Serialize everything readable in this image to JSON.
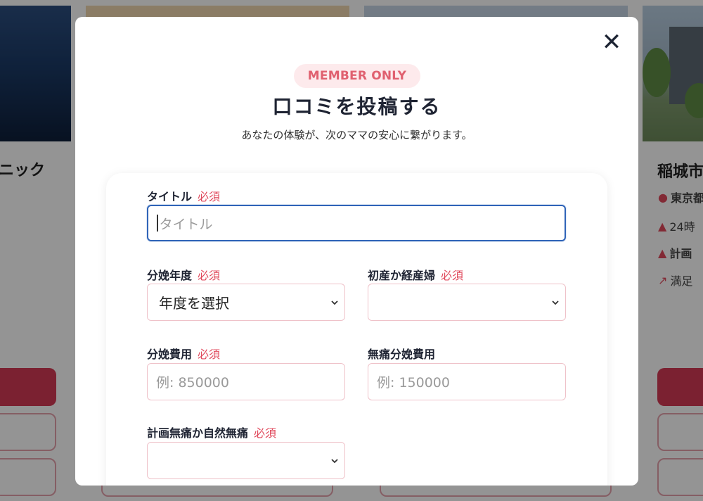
{
  "background": {
    "left_card": {
      "title_fragment": "ニック"
    },
    "right_card": {
      "title_fragment": "稲城市",
      "lines": [
        "東京都",
        "24時",
        "計画",
        "満足"
      ]
    }
  },
  "modal": {
    "close_label": "✕",
    "badge": "MEMBER ONLY",
    "title": "口コミを投稿する",
    "subtitle": "あなたの体験が、次のママの安心に繋がります。",
    "required_label": "必須",
    "fields": {
      "title": {
        "label": "タイトル",
        "placeholder": "タイトル"
      },
      "delivery_year": {
        "label": "分娩年度",
        "value": "年度を選択"
      },
      "parity": {
        "label": "初産か経産婦",
        "value": ""
      },
      "delivery_cost": {
        "label": "分娩費用",
        "placeholder": "例: 850000"
      },
      "painless_cost": {
        "label": "無痛分娩費用",
        "placeholder": "例: 150000"
      },
      "painless_type": {
        "label": "計画無痛か自然無痛",
        "value": ""
      }
    }
  }
}
